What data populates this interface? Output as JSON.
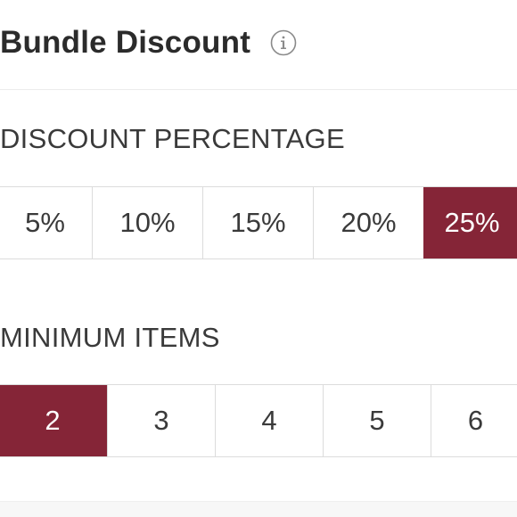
{
  "header": {
    "title": "Bundle Discount",
    "info_icon": "info-circle-icon"
  },
  "discount_percentage": {
    "label": "DISCOUNT PERCENTAGE",
    "options": [
      "5%",
      "10%",
      "15%",
      "20%",
      "25%"
    ],
    "selected": "25%"
  },
  "minimum_items": {
    "label": "MINIMUM ITEMS",
    "options": [
      "2",
      "3",
      "4",
      "5",
      "6"
    ],
    "selected": "2"
  },
  "colors": {
    "accent": "#852537",
    "text": "#2b2b2b",
    "border": "#dcdcdc"
  }
}
